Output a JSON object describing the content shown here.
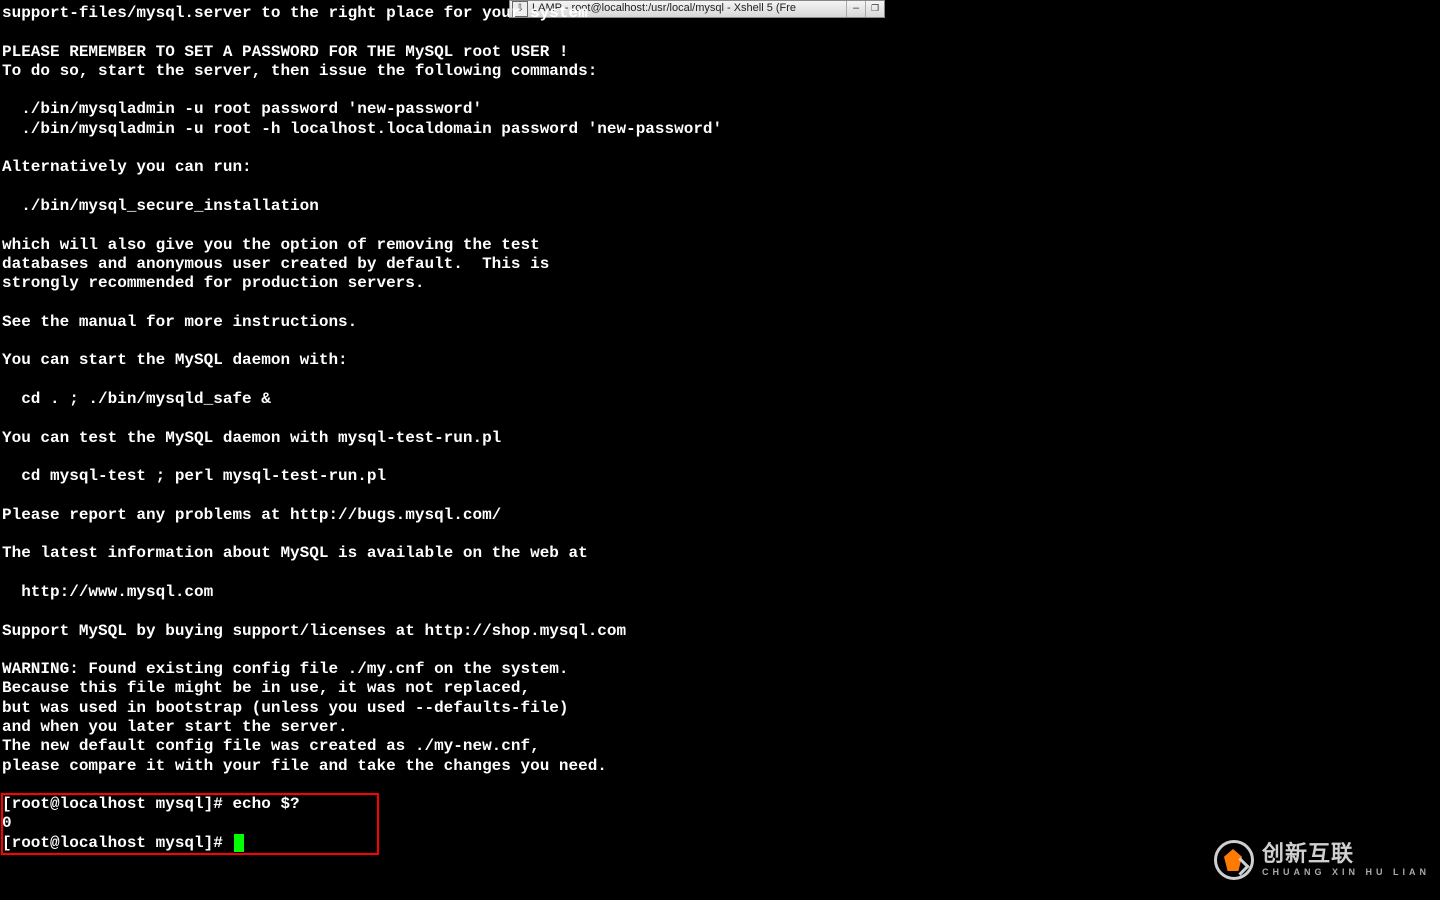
{
  "titlebar": {
    "text": "LAMP - root@localhost:/usr/local/mysql - Xshell 5 (Fre"
  },
  "terminal": {
    "body": "support-files/mysql.server to the right place for your system\n\nPLEASE REMEMBER TO SET A PASSWORD FOR THE MySQL root USER !\nTo do so, start the server, then issue the following commands:\n\n  ./bin/mysqladmin -u root password 'new-password'\n  ./bin/mysqladmin -u root -h localhost.localdomain password 'new-password'\n\nAlternatively you can run:\n\n  ./bin/mysql_secure_installation\n\nwhich will also give you the option of removing the test\ndatabases and anonymous user created by default.  This is\nstrongly recommended for production servers.\n\nSee the manual for more instructions.\n\nYou can start the MySQL daemon with:\n\n  cd . ; ./bin/mysqld_safe &\n\nYou can test the MySQL daemon with mysql-test-run.pl\n\n  cd mysql-test ; perl mysql-test-run.pl\n\nPlease report any problems at http://bugs.mysql.com/\n\nThe latest information about MySQL is available on the web at\n\n  http://www.mysql.com\n\nSupport MySQL by buying support/licenses at http://shop.mysql.com\n\nWARNING: Found existing config file ./my.cnf on the system.\nBecause this file might be in use, it was not replaced,\nbut was used in bootstrap (unless you used --defaults-file)\nand when you later start the server.\nThe new default config file was created as ./my-new.cnf,\nplease compare it with your file and take the changes you need.\n",
    "prompt_line_1": "[root@localhost mysql]# echo $?",
    "echo_result": "0",
    "prompt_line_2": "[root@localhost mysql]# "
  },
  "watermark": {
    "main": "创新互联",
    "sub": "CHUANG XIN HU LIAN"
  }
}
